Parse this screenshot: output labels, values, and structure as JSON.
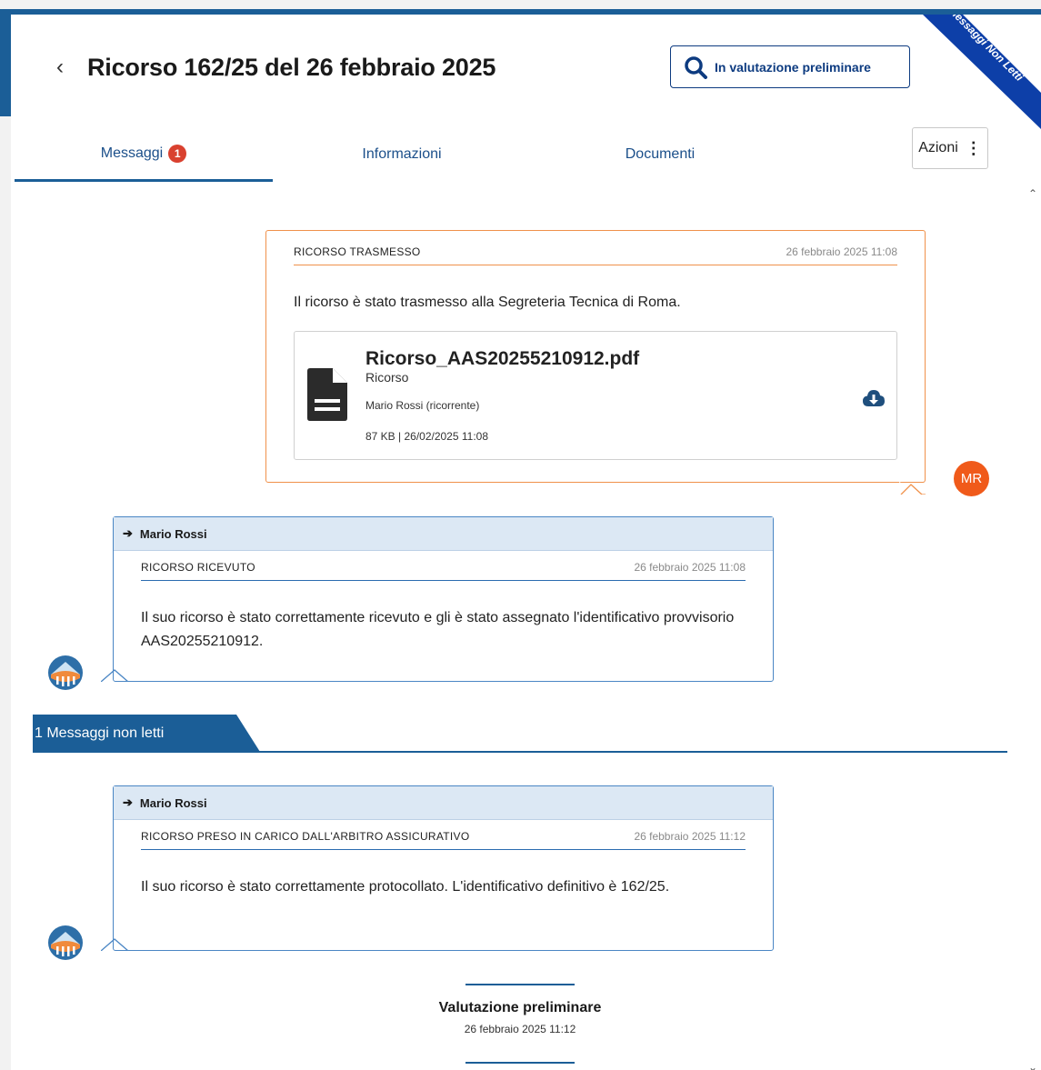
{
  "header": {
    "back_icon": "chevron-left-icon",
    "title": "Ricorso 162/25 del 26 febbraio 2025",
    "status_icon": "search-icon",
    "status_label": "In valutazione preliminare",
    "ribbon_label": "Messaggi Non Letti",
    "ribbon_color": "#0d3fa8"
  },
  "tabs": [
    {
      "label": "Messaggi",
      "badge": "1"
    },
    {
      "label": "Informazioni"
    },
    {
      "label": "Documenti"
    }
  ],
  "actions": {
    "label": "Azioni",
    "icon": "more-vertical-icon"
  },
  "messages": {
    "sent": {
      "type": "RICORSO TRASMESSO",
      "date": "26 febbraio 2025 11:08",
      "body": "Il ricorso è stato trasmesso alla Segreteria Tecnica di Roma.",
      "attachment": {
        "file_name": "Ricorso_AAS20255210912.pdf",
        "doc_type": "Ricorso",
        "owner": "Mario Rossi (ricorrente)",
        "meta": "87 KB | 26/02/2025 11:08",
        "icon": "file-icon",
        "download_icon": "cloud-download-icon"
      },
      "avatar_initials": "MR",
      "avatar_color": "#f05a1a"
    },
    "received": [
      {
        "sender": "Mario Rossi",
        "type": "RICORSO RICEVUTO",
        "date": "26 febbraio 2025 11:08",
        "body": "Il suo ricorso è stato correttamente ricevuto e gli è stato assegnato l'identificativo provvisorio AAS20255210912."
      },
      {
        "sender": "Mario Rossi",
        "type": "RICORSO PRESO IN CARICO DALL'ARBITRO ASSICURATIVO",
        "date": "26 febbraio 2025 11:12",
        "body": "Il suo ricorso è stato correttamente protocollato. L'identificativo definitivo è 162/25."
      }
    ]
  },
  "unread_divider": {
    "label": "1 Messaggi non letti"
  },
  "timeline_event": {
    "title": "Valutazione preliminare",
    "date": "26 febbraio 2025 11:12"
  },
  "colors": {
    "primary": "#1b5e97",
    "accent_outgoing": "#f0914a",
    "incoming_border": "#4a86c4",
    "badge": "#d9412f"
  }
}
